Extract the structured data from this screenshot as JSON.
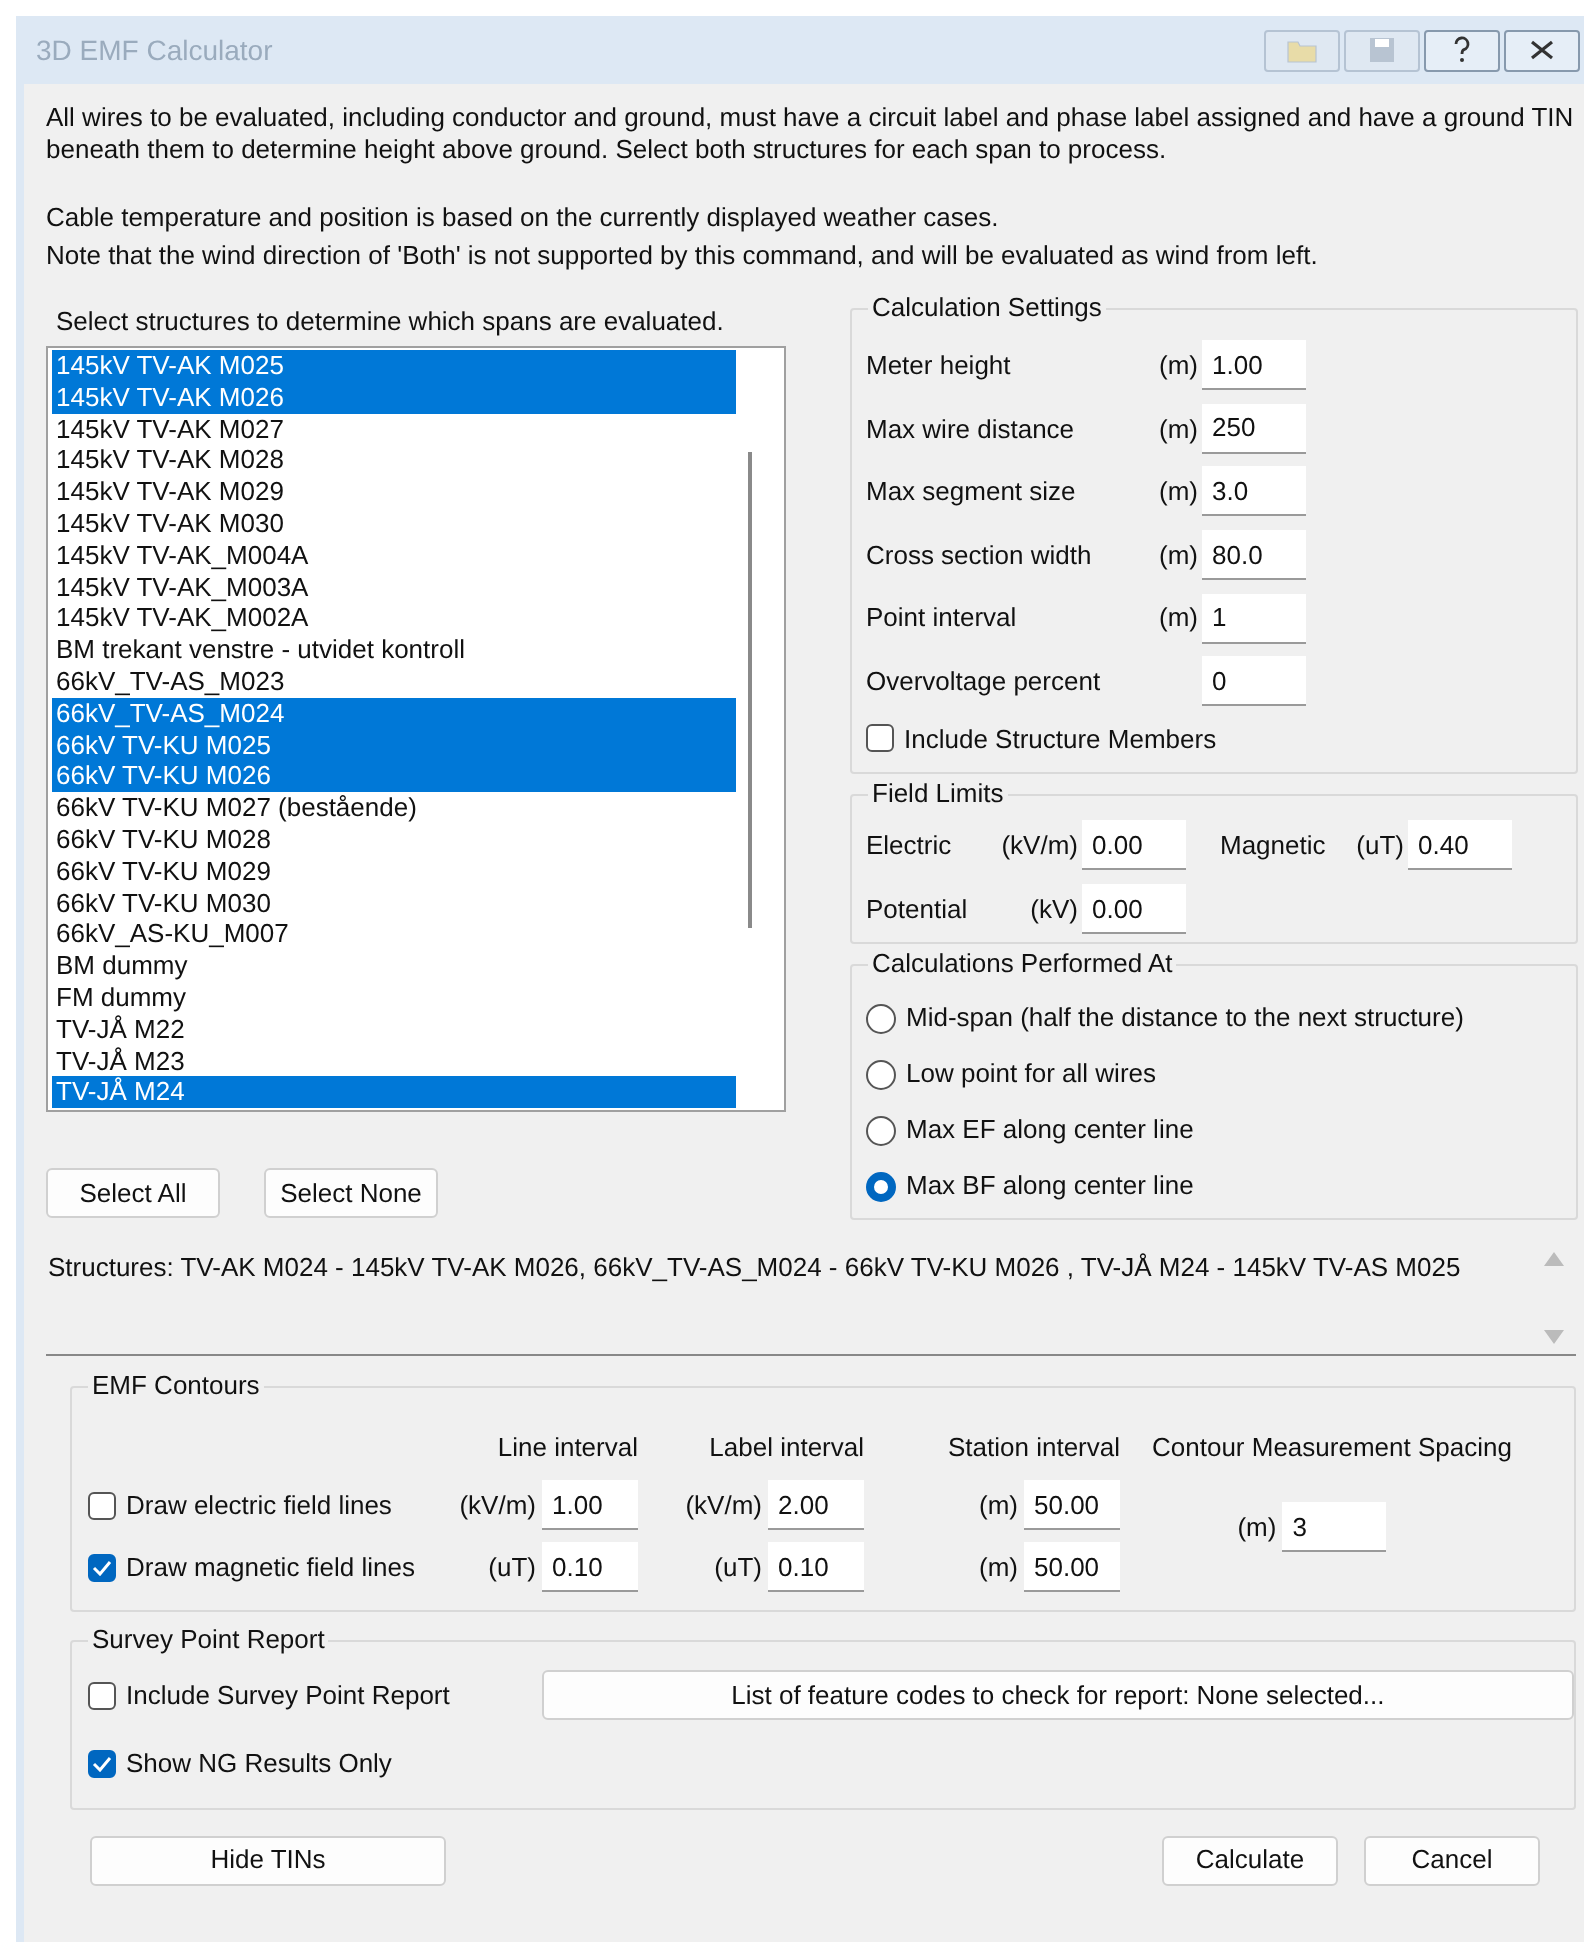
{
  "window": {
    "title": "3D EMF Calculator"
  },
  "title_buttons": [
    {
      "kind": "open",
      "disabled": true
    },
    {
      "kind": "save",
      "disabled": true
    },
    {
      "kind": "help",
      "disabled": false
    },
    {
      "kind": "close",
      "disabled": false
    }
  ],
  "intro": [
    "All wires to be evaluated, including conductor and ground, must have a circuit label and phase label assigned and have a ground TIN beneath them to determine height above ground. Select both structures for each span to process.",
    "Cable temperature and position is based on the currently displayed weather cases.",
    "Note that the wind direction of 'Both' is not supported by this command, and will be evaluated as wind from left."
  ],
  "structures_list": {
    "label": "Select structures to determine which spans are evaluated.",
    "items": [
      {
        "label": "145kV TV-AK M025",
        "selected": true
      },
      {
        "label": "145kV TV-AK M026",
        "selected": true
      },
      {
        "label": "145kV TV-AK M027",
        "selected": false
      },
      {
        "label": "145kV TV-AK M028",
        "selected": false
      },
      {
        "label": "145kV TV-AK M029",
        "selected": false
      },
      {
        "label": "145kV TV-AK M030",
        "selected": false
      },
      {
        "label": "145kV TV-AK_M004A",
        "selected": false
      },
      {
        "label": "145kV TV-AK_M003A",
        "selected": false
      },
      {
        "label": "145kV TV-AK_M002A",
        "selected": false
      },
      {
        "label": "BM trekant venstre - utvidet kontroll",
        "selected": false
      },
      {
        "label": "66kV_TV-AS_M023",
        "selected": false
      },
      {
        "label": "66kV_TV-AS_M024",
        "selected": true
      },
      {
        "label": "66kV TV-KU M025",
        "selected": true
      },
      {
        "label": "66kV TV-KU M026",
        "selected": true
      },
      {
        "label": "66kV TV-KU M027 (bestående)",
        "selected": false
      },
      {
        "label": "66kV TV-KU M028",
        "selected": false
      },
      {
        "label": "66kV TV-KU M029",
        "selected": false
      },
      {
        "label": "66kV TV-KU M030",
        "selected": false
      },
      {
        "label": "66kV_AS-KU_M007",
        "selected": false
      },
      {
        "label": "BM dummy",
        "selected": false
      },
      {
        "label": "FM dummy",
        "selected": false
      },
      {
        "label": "TV-JÅ M22",
        "selected": false
      },
      {
        "label": "TV-JÅ M23",
        "selected": false
      },
      {
        "label": "TV-JÅ M24",
        "selected": true
      }
    ]
  },
  "list_buttons": [
    "Select All",
    "Select None"
  ],
  "calculation_settings": {
    "title": "Calculation Settings",
    "fields": [
      {
        "label": "Meter height",
        "unit": "(m)",
        "value": "1.00"
      },
      {
        "label": "Max wire distance",
        "unit": "(m)",
        "value": "250"
      },
      {
        "label": "Max segment size",
        "unit": "(m)",
        "value": "3.0"
      },
      {
        "label": "Cross section width",
        "unit": "(m)",
        "value": "80.0"
      },
      {
        "label": "Point interval",
        "unit": "(m)",
        "value": "1"
      },
      {
        "label": "Overvoltage percent",
        "value": "0"
      }
    ],
    "include_structure_members": {
      "label": "Include Structure Members",
      "checked": false
    }
  },
  "field_limits": {
    "title": "Field Limits",
    "fields": [
      {
        "label": "Electric",
        "unit": "(kV/m)",
        "value": "0.00"
      },
      {
        "label": "Magnetic",
        "unit": "(uT)",
        "value": "0.40"
      },
      {
        "label": "Potential",
        "unit": "(kV)",
        "value": "0.00"
      }
    ]
  },
  "calculations_performed_at": {
    "title": "Calculations Performed At",
    "options": [
      {
        "label": "Mid-span (half the distance to the next structure)",
        "selected": false
      },
      {
        "label": "Low point for all wires",
        "selected": false
      },
      {
        "label": "Max EF along center line",
        "selected": false
      },
      {
        "label": "Max BF along center line",
        "selected": true
      }
    ]
  },
  "structures_summary": "Structures: TV-AK M024 - 145kV TV-AK M026, 66kV_TV-AS_M024 - 66kV TV-KU M026 , TV-JÅ M24 - 145kV TV-AS M025",
  "emf_contours": {
    "title": "EMF Contours",
    "columns": [
      "Line interval",
      "Label interval",
      "Station interval",
      "Contour Measurement Spacing"
    ],
    "rows": [
      {
        "label": "Draw electric field lines",
        "checked": false,
        "cells": [
          {
            "unit": "(kV/m)",
            "value": "1.00"
          },
          {
            "unit": "(kV/m)",
            "value": "2.00"
          },
          {
            "unit": "(m)",
            "value": "50.00"
          }
        ]
      },
      {
        "label": "Draw magnetic field lines",
        "checked": true,
        "cells": [
          {
            "unit": "(uT)",
            "value": "0.10"
          },
          {
            "unit": "(uT)",
            "value": "0.10"
          },
          {
            "unit": "(m)",
            "value": "50.00"
          }
        ]
      }
    ],
    "spacing": {
      "unit": "(m)",
      "value": "3"
    }
  },
  "survey_point_report": {
    "title": "Survey Point Report",
    "include": {
      "label": "Include Survey Point Report",
      "checked": false
    },
    "feature_codes_button": "List of feature codes to check for report: None selected...",
    "show_ng": {
      "label": "Show NG Results Only",
      "checked": true
    }
  },
  "buttons": {
    "hide_tins": "Hide TINs",
    "calculate": "Calculate",
    "cancel": "Cancel"
  }
}
